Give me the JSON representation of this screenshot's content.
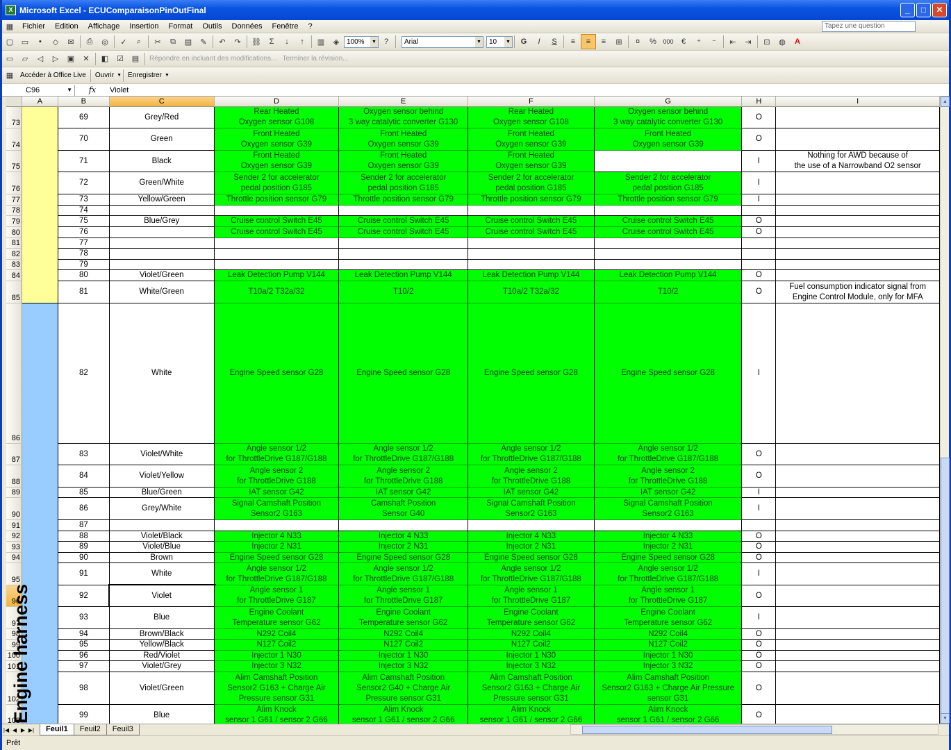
{
  "window": {
    "app": "Microsoft Excel",
    "title": "Microsoft Excel - ECUComparaisonPinOutFinal"
  },
  "menu": [
    {
      "label": "Fichier"
    },
    {
      "label": "Edition"
    },
    {
      "label": "Affichage"
    },
    {
      "label": "Insertion"
    },
    {
      "label": "Format"
    },
    {
      "label": "Outils"
    },
    {
      "label": "Données"
    },
    {
      "label": "Fenêtre"
    },
    {
      "label": "?"
    }
  ],
  "ask_placeholder": "Tapez une question",
  "toolbar": {
    "zoom": "100%",
    "font": "Arial",
    "size": "10",
    "bold": "G",
    "italic": "I",
    "underline": "S",
    "percent": "%",
    "thousands": "000",
    "euro": "€"
  },
  "reviewing": {
    "reply": "Répondre en incluant des modifications...",
    "end_review": "Terminer la révision..."
  },
  "officelive": {
    "access": "Accéder à Office Live",
    "open": "Ouvrir",
    "save": "Enregistrer"
  },
  "namebox": "C96",
  "formula": "Violet",
  "fx": "fx",
  "columns": [
    "A",
    "B",
    "C",
    "D",
    "E",
    "F",
    "G",
    "H",
    "I"
  ],
  "harness_label": "Engine harness",
  "rows": [
    {
      "r": "73",
      "b": "69",
      "c": "Grey/Red",
      "d": "Rear Heated\nOxygen sensor G108",
      "e": "Oxygen sensor behind\n3 way catalytic converter G130",
      "f": "Rear Heated\nOxygen sensor G108",
      "g": "Oxygen sensor behind\n3 way catalytic converter G130",
      "h": "O",
      "i": ""
    },
    {
      "r": "74",
      "b": "70",
      "c": "Green",
      "d": "Front Heated\nOxygen sensor G39",
      "e": "Front Heated\nOxygen sensor G39",
      "f": "Front Heated\nOxygen sensor G39",
      "g": "Front Heated\nOxygen sensor G39",
      "h": "O",
      "i": ""
    },
    {
      "r": "75",
      "b": "71",
      "c": "Black",
      "d": "Front Heated\nOxygen sensor G39",
      "e": "Front Heated\nOxygen sensor G39",
      "f": "Front Heated\nOxygen sensor G39",
      "g": "",
      "h": "I",
      "i": "Nothing for AWD because of\nthe use of a Narrowband O2 sensor"
    },
    {
      "r": "76",
      "b": "72",
      "c": "Green/White",
      "d": "Sender 2 for accelerator\npedal position G185",
      "e": "Sender 2 for accelerator\npedal position G185",
      "f": "Sender 2 for accelerator\npedal position G185",
      "g": "Sender 2 for accelerator\npedal position G185",
      "h": "I",
      "i": ""
    },
    {
      "r": "77",
      "b": "73",
      "c": "Yellow/Green",
      "d": "Throttle position sensor G79",
      "e": "Throttle position sensor G79",
      "f": "Throttle position sensor G79",
      "g": "Throttle position sensor G79",
      "h": "I",
      "i": ""
    },
    {
      "r": "78",
      "b": "74",
      "c": "",
      "d": "",
      "e": "",
      "f": "",
      "g": "",
      "h": "",
      "i": ""
    },
    {
      "r": "79",
      "b": "75",
      "c": "Blue/Grey",
      "d": "Cruise control Switch E45",
      "e": "Cruise control Switch E45",
      "f": "Cruise control Switch E45",
      "g": "Cruise control Switch E45",
      "h": "O",
      "i": ""
    },
    {
      "r": "80",
      "b": "76",
      "c": "",
      "d": "Cruise control Switch E45",
      "e": "Cruise control Switch E45",
      "f": "Cruise control Switch E45",
      "g": "Cruise control Switch E45",
      "h": "O",
      "i": ""
    },
    {
      "r": "81",
      "b": "77",
      "c": "",
      "d": "",
      "e": "",
      "f": "",
      "g": "",
      "h": "",
      "i": ""
    },
    {
      "r": "82",
      "b": "78",
      "c": "",
      "d": "",
      "e": "",
      "f": "",
      "g": "",
      "h": "",
      "i": ""
    },
    {
      "r": "83",
      "b": "79",
      "c": "",
      "d": "",
      "e": "",
      "f": "",
      "g": "",
      "h": "",
      "i": ""
    },
    {
      "r": "84",
      "b": "80",
      "c": "Violet/Green",
      "d": "Leak Detection Pump V144",
      "e": "Leak Detection Pump V144",
      "f": "Leak Detection Pump V144",
      "g": "Leak Detection Pump V144",
      "h": "O",
      "i": ""
    },
    {
      "r": "85",
      "b": "81",
      "c": "White/Green",
      "d": "T10a/2 T32a/32",
      "e": "T10/2",
      "f": "T10a/2 T32a/32",
      "g": "T10/2",
      "h": "O",
      "i": "Fuel consumption indicator signal from\nEngine Control Module, only for MFA"
    },
    {
      "r": "86",
      "b": "82",
      "c": "White",
      "d": "Engine Speed sensor G28",
      "e": "Engine Speed sensor G28",
      "f": "Engine Speed sensor G28",
      "g": "Engine Speed sensor G28",
      "h": "I",
      "i": ""
    },
    {
      "r": "87",
      "b": "83",
      "c": "Violet/White",
      "d": "Angle sensor 1/2\nfor ThrottleDrive G187/G188",
      "e": "Angle sensor 1/2\nfor ThrottleDrive G187/G188",
      "f": "Angle sensor 1/2\nfor ThrottleDrive G187/G188",
      "g": "Angle sensor 1/2\nfor ThrottleDrive G187/G188",
      "h": "O",
      "i": ""
    },
    {
      "r": "88",
      "b": "84",
      "c": "Violet/Yellow",
      "d": "Angle sensor 2\nfor ThrottleDrive G188",
      "e": "Angle sensor 2\nfor ThrottleDrive G188",
      "f": "Angle sensor 2\nfor ThrottleDrive G188",
      "g": "Angle sensor 2\nfor ThrottleDrive G188",
      "h": "O",
      "i": ""
    },
    {
      "r": "89",
      "b": "85",
      "c": "Blue/Green",
      "d": "IAT sensor G42",
      "e": "IAT sensor G42",
      "f": "IAT sensor G42",
      "g": "IAT sensor G42",
      "h": "I",
      "i": ""
    },
    {
      "r": "90",
      "b": "86",
      "c": "Grey/White",
      "d": "Signal Camshaft Position\nSensor2 G163",
      "e": "Camshaft Position\nSensor G40",
      "f": "Signal Camshaft Position\nSensor2 G163",
      "g": "Signal Camshaft Position\nSensor2 G163",
      "h": "I",
      "i": ""
    },
    {
      "r": "91",
      "b": "87",
      "c": "",
      "d": "",
      "e": "",
      "f": "",
      "g": "",
      "h": "",
      "i": ""
    },
    {
      "r": "92",
      "b": "88",
      "c": "Violet/Black",
      "d": "Injector 4 N33",
      "e": "Injector 4 N33",
      "f": "Injector 4 N33",
      "g": "Injector 4 N33",
      "h": "O",
      "i": ""
    },
    {
      "r": "93",
      "b": "89",
      "c": "Violet/Blue",
      "d": "Injector 2 N31",
      "e": "Injector 2 N31",
      "f": "Injector 2 N31",
      "g": "Injector 2 N31",
      "h": "O",
      "i": ""
    },
    {
      "r": "94",
      "b": "90",
      "c": "Brown",
      "d": "Engine Speed sensor G28",
      "e": "Engine Speed sensor G28",
      "f": "Engine Speed sensor G28",
      "g": "Engine Speed sensor G28",
      "h": "O",
      "i": ""
    },
    {
      "r": "95",
      "b": "91",
      "c": "White",
      "d": "Angle sensor 1/2\nfor ThrottleDrive G187/G188",
      "e": "Angle sensor 1/2\nfor ThrottleDrive G187/G188",
      "f": "Angle sensor 1/2\nfor ThrottleDrive G187/G188",
      "g": "Angle sensor 1/2\nfor ThrottleDrive G187/G188",
      "h": "I",
      "i": ""
    },
    {
      "r": "96",
      "b": "92",
      "c": "Violet",
      "d": "Angle sensor 1\nfor ThrottleDrive G187",
      "e": "Angle sensor 1\nfor ThrottleDrive G187",
      "f": "Angle sensor 1\nfor ThrottleDrive G187",
      "g": "Angle sensor 1\nfor ThrottleDrive G187",
      "h": "O",
      "i": ""
    },
    {
      "r": "97",
      "b": "93",
      "c": "Blue",
      "d": "Engine Coolant\nTemperature sensor G62",
      "e": "Engine Coolant\nTemperature sensor G62",
      "f": "Engine Coolant\nTemperature sensor G62",
      "g": "Engine Coolant\nTemperature sensor G62",
      "h": "I",
      "i": ""
    },
    {
      "r": "98",
      "b": "94",
      "c": "Brown/Black",
      "d": "N292 Coil4",
      "e": "N292 Coil4",
      "f": "N292 Coil4",
      "g": "N292 Coil4",
      "h": "O",
      "i": ""
    },
    {
      "r": "99",
      "b": "95",
      "c": "Yellow/Black",
      "d": "N127 Coil2",
      "e": "N127 Coil2",
      "f": "N127 Coil2",
      "g": "N127 Coil2",
      "h": "O",
      "i": ""
    },
    {
      "r": "100",
      "b": "96",
      "c": "Red/Violet",
      "d": "Injector 1 N30",
      "e": "Injector 1 N30",
      "f": "Injector 1 N30",
      "g": "Injector 1 N30",
      "h": "O",
      "i": ""
    },
    {
      "r": "101",
      "b": "97",
      "c": "Violet/Grey",
      "d": "Injector 3 N32",
      "e": "Injector 3 N32",
      "f": "Injector 3 N32",
      "g": "Injector 3 N32",
      "h": "O",
      "i": ""
    },
    {
      "r": "102",
      "b": "98",
      "c": "Violet/Green",
      "d": "Alim Camshaft Position\nSensor2 G163 + Charge Air\nPressure sensor G31",
      "e": "Alim Camshaft Position\nSensor2 G40 + Charge Air\nPressure sensor G31",
      "f": "Alim Camshaft Position\nSensor2 G163 + Charge Air\nPressure sensor G31",
      "g": "Alim Camshaft Position\nSensor2 G163 + Charge Air Pressure\nsensor G31",
      "h": "O",
      "i": ""
    },
    {
      "r": "103",
      "b": "99",
      "c": "Blue",
      "d": "Alim Knock\nsensor 1 G61 / sensor 2 G66",
      "e": "Alim Knock\nsensor 1 G61 / sensor 2 G66",
      "f": "Alim Knock\nsensor 1 G61 / sensor 2 G66",
      "g": "Alim Knock\nsensor 1 G61 / sensor 2 G66",
      "h": "O",
      "i": ""
    }
  ],
  "sheets": [
    {
      "label": "Feuil1"
    },
    {
      "label": "Feuil2"
    },
    {
      "label": "Feuil3"
    }
  ],
  "status": "Prêt",
  "colors": {
    "green_cell": "#00ff00",
    "yellow_band": "#ffff99",
    "blue_band": "#99ccff",
    "titlebar": "#0a55e0"
  }
}
